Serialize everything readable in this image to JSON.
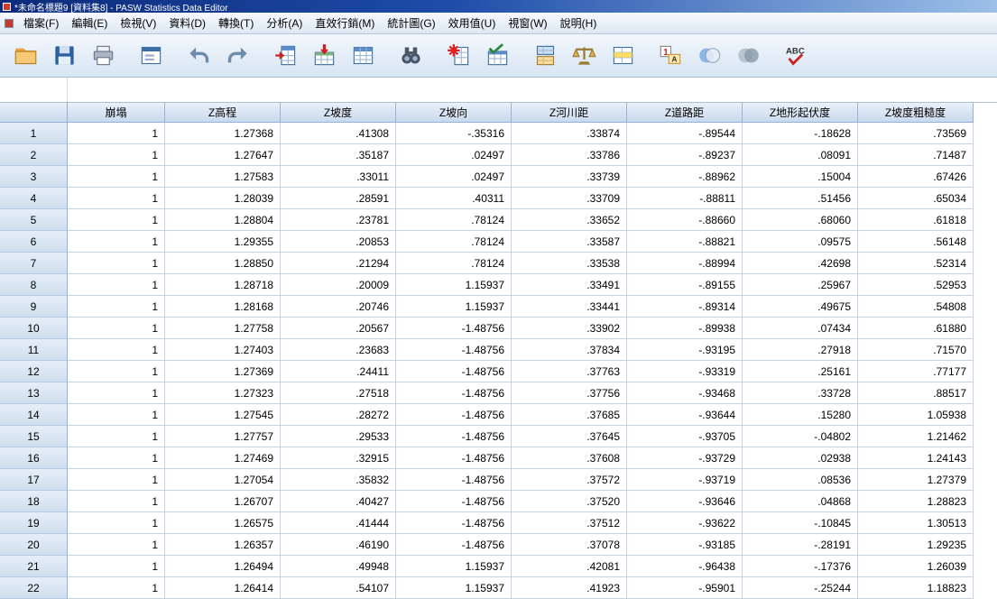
{
  "window": {
    "title": "*未命名標題9 [資料集8] - PASW Statistics Data Editor"
  },
  "menu": {
    "items": [
      {
        "name": "file",
        "label": "檔案(F)"
      },
      {
        "name": "edit",
        "label": "編輯(E)"
      },
      {
        "name": "view",
        "label": "檢視(V)"
      },
      {
        "name": "data",
        "label": "資料(D)"
      },
      {
        "name": "transform",
        "label": "轉換(T)"
      },
      {
        "name": "analyze",
        "label": "分析(A)"
      },
      {
        "name": "direct-marketing",
        "label": "直效行銷(M)"
      },
      {
        "name": "graphs",
        "label": "統計圖(G)"
      },
      {
        "name": "utilities",
        "label": "效用值(U)"
      },
      {
        "name": "window",
        "label": "視窗(W)"
      },
      {
        "name": "help",
        "label": "說明(H)"
      }
    ]
  },
  "toolbar": {
    "icons": [
      "open-file",
      "save",
      "print",
      "recall-dialogs",
      "undo",
      "redo",
      "goto-case",
      "goto-variable",
      "variables",
      "find",
      "insert-cases",
      "insert-variable",
      "split-file",
      "weight-cases",
      "select-cases",
      "value-labels",
      "use-variable-sets",
      "show-all-variables",
      "spell-check"
    ]
  },
  "grid": {
    "columns": [
      "崩塌",
      "Z高程",
      "Z坡度",
      "Z坡向",
      "Z河川距",
      "Z道路距",
      "Z地形起伏度",
      "Z坡度粗糙度"
    ],
    "rows": [
      {
        "n": "1",
        "values": [
          "1",
          "1.27368",
          ".41308",
          "-.35316",
          ".33874",
          "-.89544",
          "-.18628",
          ".73569"
        ]
      },
      {
        "n": "2",
        "values": [
          "1",
          "1.27647",
          ".35187",
          ".02497",
          ".33786",
          "-.89237",
          ".08091",
          ".71487"
        ]
      },
      {
        "n": "3",
        "values": [
          "1",
          "1.27583",
          ".33011",
          ".02497",
          ".33739",
          "-.88962",
          ".15004",
          ".67426"
        ]
      },
      {
        "n": "4",
        "values": [
          "1",
          "1.28039",
          ".28591",
          ".40311",
          ".33709",
          "-.88811",
          ".51456",
          ".65034"
        ]
      },
      {
        "n": "5",
        "values": [
          "1",
          "1.28804",
          ".23781",
          ".78124",
          ".33652",
          "-.88660",
          ".68060",
          ".61818"
        ]
      },
      {
        "n": "6",
        "values": [
          "1",
          "1.29355",
          ".20853",
          ".78124",
          ".33587",
          "-.88821",
          ".09575",
          ".56148"
        ]
      },
      {
        "n": "7",
        "values": [
          "1",
          "1.28850",
          ".21294",
          ".78124",
          ".33538",
          "-.88994",
          ".42698",
          ".52314"
        ]
      },
      {
        "n": "8",
        "values": [
          "1",
          "1.28718",
          ".20009",
          "1.15937",
          ".33491",
          "-.89155",
          ".25967",
          ".52953"
        ]
      },
      {
        "n": "9",
        "values": [
          "1",
          "1.28168",
          ".20746",
          "1.15937",
          ".33441",
          "-.89314",
          ".49675",
          ".54808"
        ]
      },
      {
        "n": "10",
        "values": [
          "1",
          "1.27758",
          ".20567",
          "-1.48756",
          ".33902",
          "-.89938",
          ".07434",
          ".61880"
        ]
      },
      {
        "n": "11",
        "values": [
          "1",
          "1.27403",
          ".23683",
          "-1.48756",
          ".37834",
          "-.93195",
          ".27918",
          ".71570"
        ]
      },
      {
        "n": "12",
        "values": [
          "1",
          "1.27369",
          ".24411",
          "-1.48756",
          ".37763",
          "-.93319",
          ".25161",
          ".77177"
        ]
      },
      {
        "n": "13",
        "values": [
          "1",
          "1.27323",
          ".27518",
          "-1.48756",
          ".37756",
          "-.93468",
          ".33728",
          ".88517"
        ]
      },
      {
        "n": "14",
        "values": [
          "1",
          "1.27545",
          ".28272",
          "-1.48756",
          ".37685",
          "-.93644",
          ".15280",
          "1.05938"
        ]
      },
      {
        "n": "15",
        "values": [
          "1",
          "1.27757",
          ".29533",
          "-1.48756",
          ".37645",
          "-.93705",
          "-.04802",
          "1.21462"
        ]
      },
      {
        "n": "16",
        "values": [
          "1",
          "1.27469",
          ".32915",
          "-1.48756",
          ".37608",
          "-.93729",
          ".02938",
          "1.24143"
        ]
      },
      {
        "n": "17",
        "values": [
          "1",
          "1.27054",
          ".35832",
          "-1.48756",
          ".37572",
          "-.93719",
          ".08536",
          "1.27379"
        ]
      },
      {
        "n": "18",
        "values": [
          "1",
          "1.26707",
          ".40427",
          "-1.48756",
          ".37520",
          "-.93646",
          ".04868",
          "1.28823"
        ]
      },
      {
        "n": "19",
        "values": [
          "1",
          "1.26575",
          ".41444",
          "-1.48756",
          ".37512",
          "-.93622",
          "-.10845",
          "1.30513"
        ]
      },
      {
        "n": "20",
        "values": [
          "1",
          "1.26357",
          ".46190",
          "-1.48756",
          ".37078",
          "-.93185",
          "-.28191",
          "1.29235"
        ]
      },
      {
        "n": "21",
        "values": [
          "1",
          "1.26494",
          ".49948",
          "1.15937",
          ".42081",
          "-.96438",
          "-.17376",
          "1.26039"
        ]
      },
      {
        "n": "22",
        "values": [
          "1",
          "1.26414",
          ".54107",
          "1.15937",
          ".41923",
          "-.95901",
          "-.25244",
          "1.18823"
        ]
      }
    ]
  }
}
